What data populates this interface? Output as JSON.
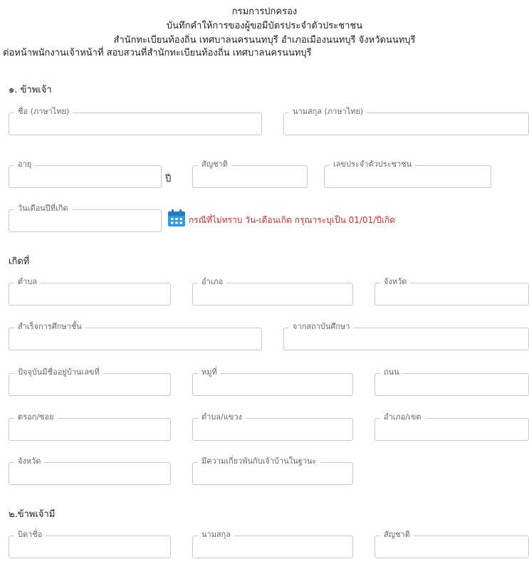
{
  "header": {
    "line1": "กรมการปกครอง",
    "line2": "บันทึกคำให้การของผู้ขอมีบัตรประจำตัวประชาชน",
    "line3": "สำนักทะเบียนท้องถิ่น เทศบาลนครนนทบุรี อำเภอเมืองนนทบุรี จังหวัดนนทบุรี",
    "line4": "ต่อหน้าพนักงานเจ้าหน้าที่ สอบสวนที่สำนักทะเบียนท้องถิ่น เทศบาลนครนนทบุรี"
  },
  "section1": {
    "title": "๑. ข้าพเจ้า"
  },
  "fields": {
    "first_name": {
      "label": "ชื่อ (ภาษาไทย)",
      "value": ""
    },
    "last_name": {
      "label": "นามสกุล (ภาษาไทย)",
      "value": ""
    },
    "age": {
      "label": "อายุ",
      "value": "",
      "unit": "ปี"
    },
    "nationality": {
      "label": "สัญชาติ",
      "value": ""
    },
    "id_number": {
      "label": "เลขประจำตัวประชาชน",
      "value": ""
    },
    "birth_date": {
      "label": "วันเดือนปีที่เกิด",
      "value": ""
    },
    "birth_subdistrict": {
      "label": "ตำบล",
      "value": ""
    },
    "birth_district": {
      "label": "อำเภอ",
      "value": ""
    },
    "birth_province": {
      "label": "จังหวัด",
      "value": ""
    },
    "education_level": {
      "label": "สำเร็จการศึกษาชั้น",
      "value": ""
    },
    "institution": {
      "label": "จากสถาบันศึกษา",
      "value": ""
    },
    "house_no": {
      "label": "ปัจจุบันมีชื่ออยู่บ้านเลขที่",
      "value": ""
    },
    "moo": {
      "label": "หมู่ที่",
      "value": ""
    },
    "road": {
      "label": "ถนน",
      "value": ""
    },
    "soi": {
      "label": "ตรอก/ซอย",
      "value": ""
    },
    "sub_district": {
      "label": "ตำบล/แขวง",
      "value": ""
    },
    "district": {
      "label": "อำเภอ/เขต",
      "value": ""
    },
    "province": {
      "label": "จังหวัด",
      "value": ""
    },
    "relation": {
      "label": "มีความเกี่ยวพันกับเจ้าบ้านในฐานะ",
      "value": ""
    },
    "father_name": {
      "label": "บิดาชื่อ",
      "value": ""
    },
    "father_last": {
      "label": "นามสกุล",
      "value": ""
    },
    "father_nat": {
      "label": "สัญชาติ",
      "value": ""
    }
  },
  "birth_note": "กรณีที่ไม่ทราบ วัน-เดือนเกิด กรุณาระบุเป็น 01/01/ปีเกิด",
  "icons": {
    "calendar": "calendar-icon"
  },
  "colors": {
    "note": "#e3272b",
    "calendar": "#2f9be0"
  },
  "birthplace": {
    "title": "เกิดที่"
  },
  "section2": {
    "title": "๒.ข้าพเจ้ามี"
  }
}
